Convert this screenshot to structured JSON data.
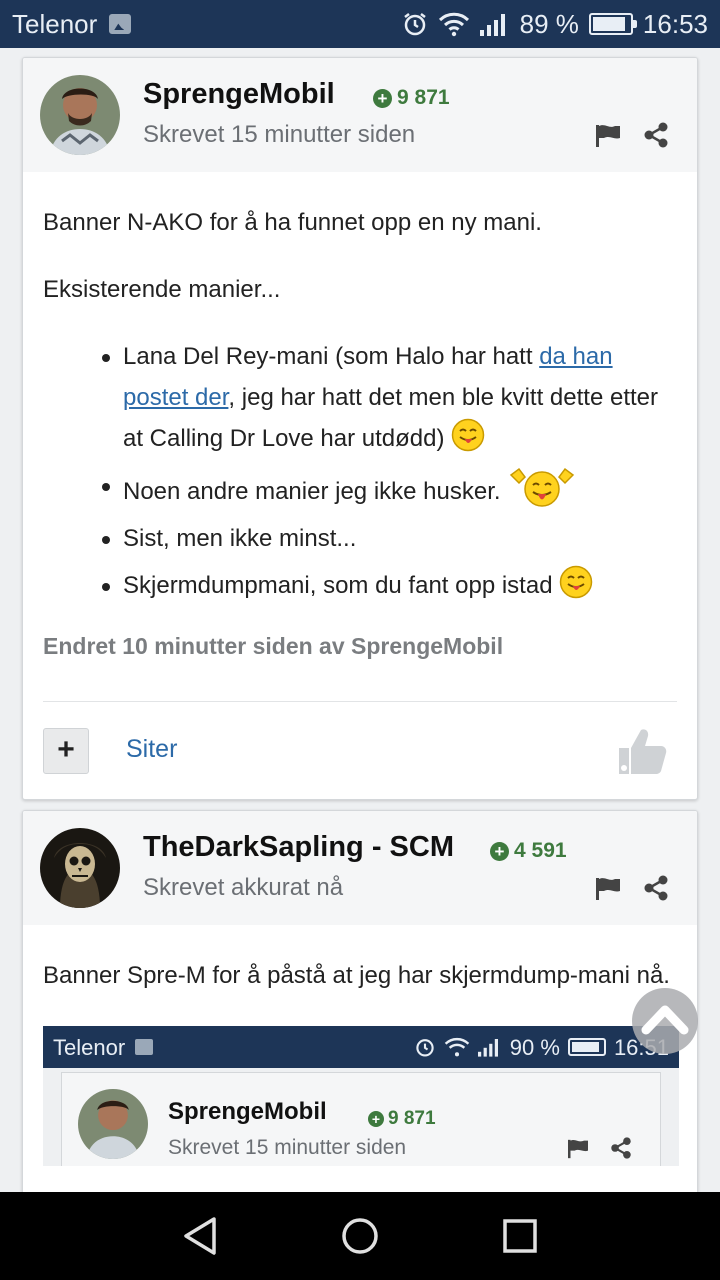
{
  "status_bar": {
    "carrier": "Telenor",
    "battery_percent": "89 %",
    "battery_level": 0.89,
    "time": "16:53"
  },
  "posts": [
    {
      "author": "SprengeMobil",
      "reputation": "9 871",
      "posted": "Skrevet 15 minutter siden",
      "paragraphs": [
        "Banner N-AKO for å ha funnet opp en ny mani.",
        "Eksisterende manier..."
      ],
      "list": {
        "item1_start": "Lana Del Rey-mani (som Halo har hatt ",
        "item1_link": "da han postet der",
        "item1_end": ", jeg har hatt det men ble kvitt dette etter at Calling Dr Love har utdødd)",
        "item2": "Noen andre manier jeg ikke husker.",
        "item3": "Sist, men ikke minst...",
        "item4": "Skjermdumpmani, som du fant opp istad"
      },
      "edited": "Endret 10 minutter siden av SprengeMobil",
      "multiquote": "+",
      "quote_label": "Siter"
    },
    {
      "author": "TheDarkSapling - SCM",
      "reputation": "4 591",
      "posted": "Skrevet akkurat nå",
      "paragraphs": [
        "Banner Spre-M for å påstå at jeg har skjermdump-mani nå."
      ],
      "screenshot": {
        "carrier": "Telenor",
        "battery_percent": "90 %",
        "time": "16:51",
        "author": "SprengeMobil",
        "reputation": "9 871",
        "posted": "Skrevet 15 minutter siden"
      }
    }
  ],
  "colors": {
    "status_bar": "#1d3557",
    "link": "#2c6aa8",
    "reputation": "#3e7a3e"
  }
}
